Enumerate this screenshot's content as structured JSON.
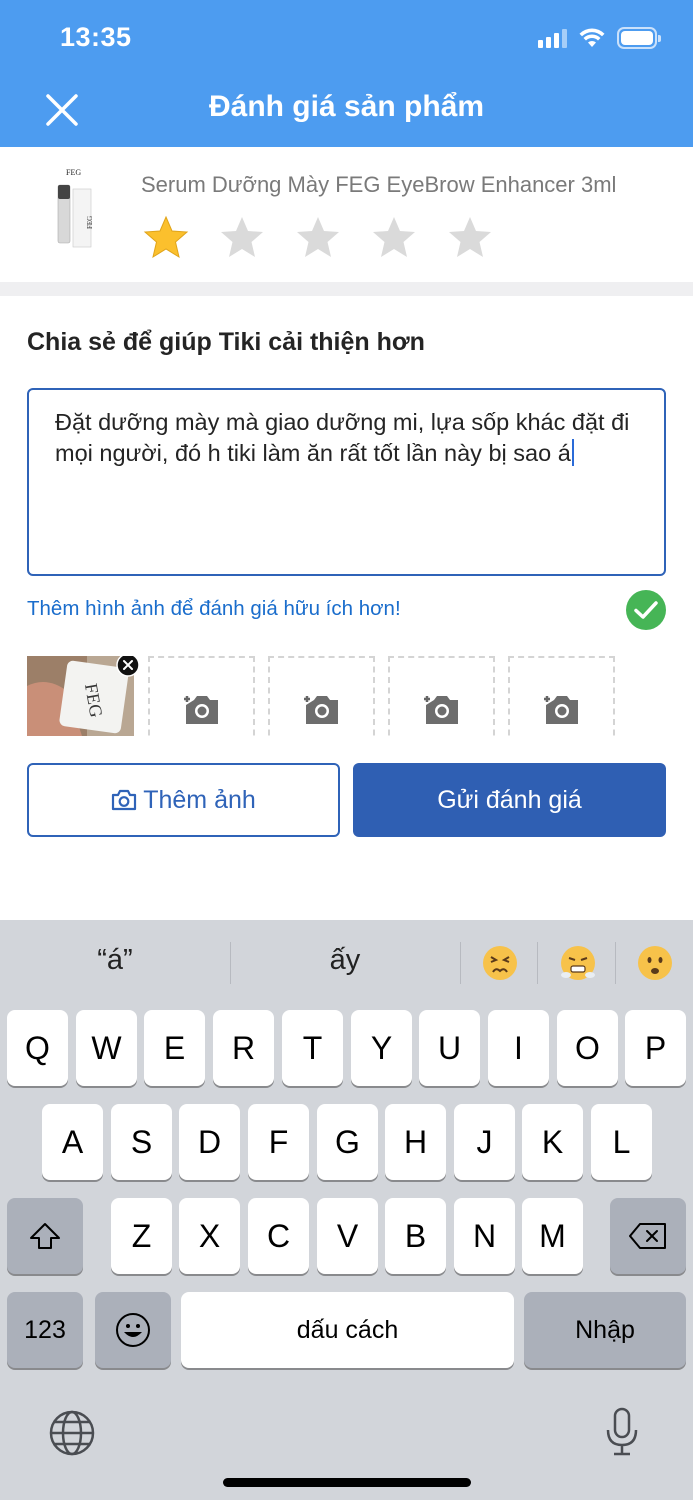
{
  "status_bar": {
    "time": "13:35"
  },
  "header": {
    "title": "Đánh giá sản phẩm",
    "close_icon": "close-icon"
  },
  "product": {
    "name": "Serum Dưỡng Mày FEG EyeBrow Enhancer 3ml",
    "rating": 1,
    "max_rating": 5,
    "star_filled_color": "#fbc02d",
    "star_empty_color": "#dadada"
  },
  "review": {
    "section_title": "Chia sẻ để giúp Tiki cải thiện hơn",
    "text": "Đặt dưỡng mày mà giao dưỡng mi, lựa sốp khác đặt đi mọi người, đó h tiki làm ăn rất tốt lần này bị sao á",
    "photo_hint": "Thêm hình ảnh để đánh giá hữu ích hơn!",
    "photo_slots": 4
  },
  "buttons": {
    "add_photo": "Thêm ảnh",
    "submit": "Gửi đánh giá"
  },
  "keyboard": {
    "suggestions": [
      "“á”",
      "ấy"
    ],
    "emoji_suggestions": [
      "persevering-face",
      "face-with-steam",
      "frowning-face"
    ],
    "row1": [
      "Q",
      "W",
      "E",
      "R",
      "T",
      "Y",
      "U",
      "I",
      "O",
      "P"
    ],
    "row2": [
      "A",
      "S",
      "D",
      "F",
      "G",
      "H",
      "J",
      "K",
      "L"
    ],
    "row3": [
      "Z",
      "X",
      "C",
      "V",
      "B",
      "N",
      "M"
    ],
    "numbers_key": "123",
    "space_key": "dấu cách",
    "return_key": "Nhập"
  },
  "colors": {
    "header": "#4d9cf0",
    "primary": "#2f5fb3",
    "link": "#1a6dcc",
    "check": "#46b556"
  }
}
